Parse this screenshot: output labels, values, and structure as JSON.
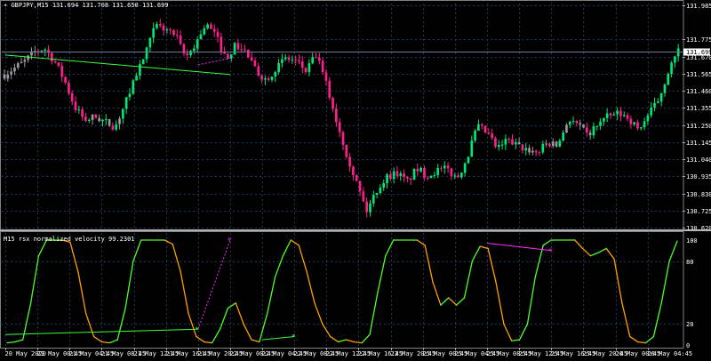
{
  "main_title": "GBPJPY,M15",
  "ohlc": "131.694 131.708 131.650 131.699",
  "current_price": "131.699",
  "indicator_title": "M15 rsx normalized velocity 99.2301",
  "colors": {
    "background": "#000000",
    "grid": "#1e3a5a",
    "bull": "#00e676",
    "bear": "#ff1f8c",
    "neutral": "#9a9a9a",
    "rsx_up": "#4cff2a",
    "rsx_down": "#ffa000",
    "trend_green": "#3cff3c",
    "trend_magenta": "#ff2aff",
    "axis_text": "#ffffff"
  },
  "chart_data": [
    {
      "type": "candlestick",
      "title": "GBPJPY,M15",
      "y_ticks": [
        "131.985",
        "131.775",
        "131.670",
        "131.565",
        "131.460",
        "131.355",
        "131.250",
        "131.145",
        "131.040",
        "130.935",
        "130.830",
        "130.725",
        "130.620"
      ],
      "ylim": [
        130.62,
        131.985
      ],
      "x_ticks": [
        "20 May 2020",
        "21 May 00:45",
        "21 May 04:45",
        "21 May 08:45",
        "21 May 12:45",
        "21 May 16:45",
        "21 May 20:45",
        "22 May 00:45",
        "22 May 04:45",
        "22 May 08:45",
        "22 May 12:45",
        "22 May 16:45",
        "22 May 20:45",
        "25 May 00:45",
        "25 May 04:45",
        "25 May 08:45",
        "25 May 12:45",
        "25 May 16:45",
        "25 May 20:45",
        "26 May 00:45",
        "26 May 04:45"
      ],
      "close_path": [
        131.56,
        131.6,
        131.64,
        131.7,
        131.72,
        131.64,
        131.52,
        131.36,
        131.28,
        131.3,
        131.27,
        131.24,
        131.38,
        131.55,
        131.68,
        131.86,
        131.84,
        131.8,
        131.66,
        131.75,
        131.87,
        131.8,
        131.66,
        131.74,
        131.7,
        131.58,
        131.53,
        131.6,
        131.66,
        131.64,
        131.58,
        131.68,
        131.5,
        131.28,
        131.08,
        130.9,
        130.72,
        130.85,
        130.93,
        130.96,
        130.9,
        130.98,
        130.94,
        130.97,
        130.98,
        130.92,
        131.05,
        131.24,
        131.2,
        131.1,
        131.16,
        131.12,
        131.1,
        131.08,
        131.14,
        131.12,
        131.28,
        131.25,
        131.18,
        131.26,
        131.3,
        131.32,
        131.3,
        131.22,
        131.31,
        131.4,
        131.58,
        131.7
      ],
      "trendlines": [
        {
          "color": "green",
          "from": [
            "20 May 2020",
            131.68
          ],
          "to": [
            "22 May 00:45",
            131.56
          ]
        },
        {
          "color": "magenta",
          "from": [
            "21 May 20:45",
            131.62
          ],
          "to": [
            "22 May 00:45",
            131.66
          ]
        }
      ]
    },
    {
      "type": "line",
      "title": "M15 rsx normalized velocity 99.2301",
      "y_ticks": [
        "100",
        "80",
        "20",
        "0"
      ],
      "ylim": [
        0,
        100
      ],
      "series": [
        {
          "color_up": "green",
          "color_down": "orange",
          "values": [
            2,
            3,
            5,
            40,
            85,
            100,
            100,
            100,
            98,
            70,
            30,
            8,
            3,
            2,
            5,
            35,
            80,
            100,
            100,
            100,
            100,
            96,
            70,
            30,
            8,
            3,
            2,
            15,
            35,
            40,
            20,
            5,
            3,
            30,
            65,
            85,
            100,
            95,
            70,
            40,
            20,
            8,
            3,
            5,
            3,
            2,
            10,
            50,
            85,
            100,
            100,
            100,
            100,
            95,
            60,
            38,
            45,
            38,
            45,
            80,
            94,
            92,
            60,
            20,
            4,
            5,
            20,
            65,
            95,
            100,
            100,
            100,
            100,
            92,
            85,
            88,
            92,
            82,
            40,
            8,
            3,
            2,
            8,
            40,
            80,
            99
          ]
        }
      ],
      "trendlines": [
        {
          "color": "green",
          "from": [
            "20 May 2020",
            10
          ],
          "to": [
            "21 May 20:45",
            15
          ]
        },
        {
          "color": "green",
          "from": [
            "22 May 04:45",
            5
          ],
          "to": [
            "22 May 08:45",
            8
          ]
        },
        {
          "color": "magenta",
          "from": [
            "21 May 20:45",
            15
          ],
          "to": [
            "22 May 00:45",
            100
          ]
        },
        {
          "color": "magenta",
          "from": [
            "25 May 08:45",
            97
          ],
          "to": [
            "25 May 16:45",
            90
          ]
        }
      ]
    }
  ]
}
